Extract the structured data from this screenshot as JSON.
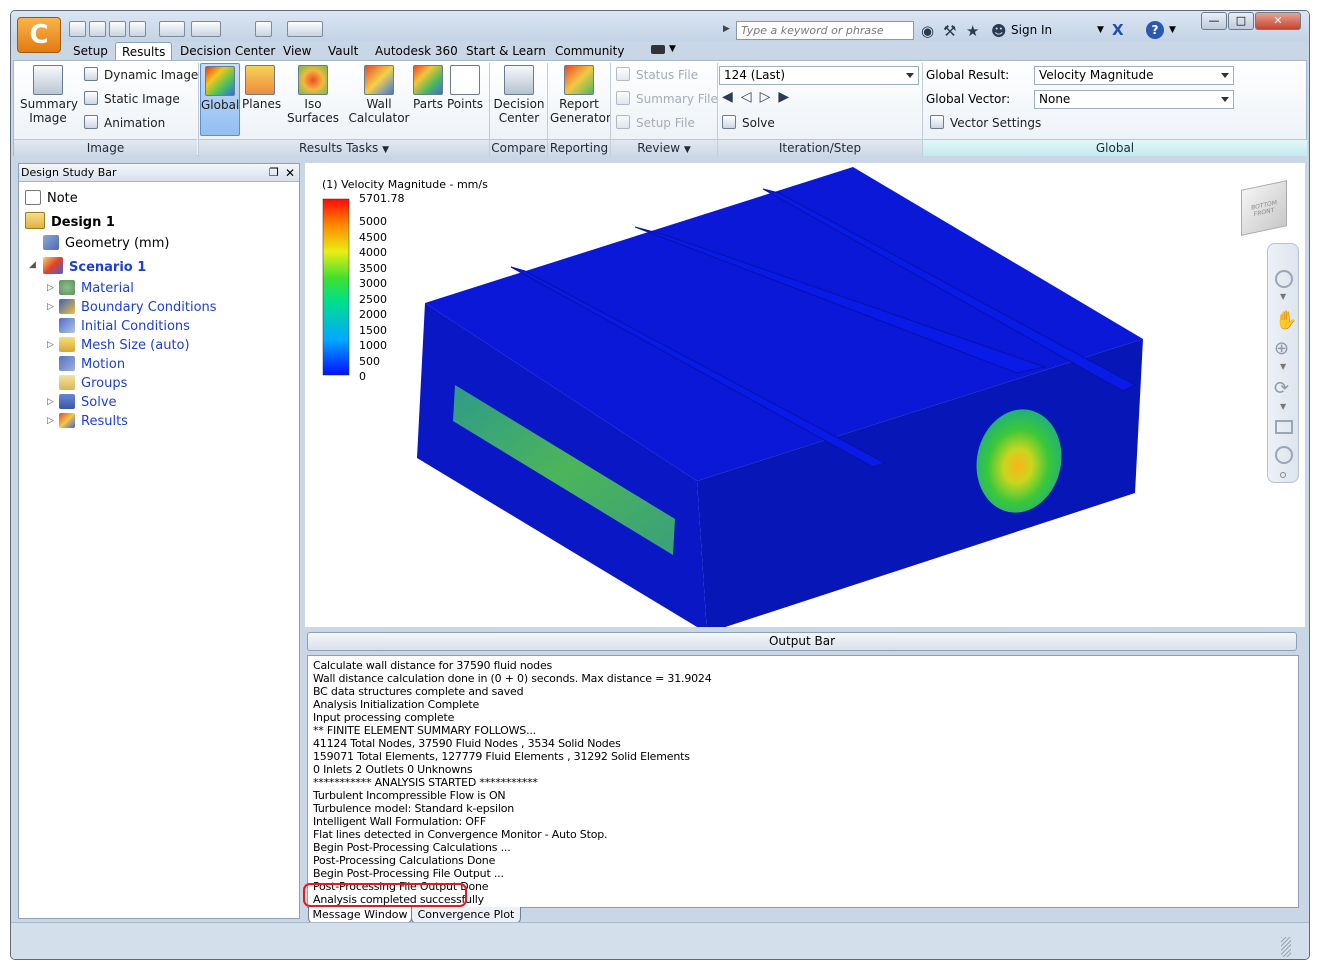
{
  "app": {
    "logo_letter": "C",
    "search_placeholder": "Type a keyword or phrase",
    "sign_in": "Sign In",
    "help": "?"
  },
  "menu_tabs": [
    "Setup",
    "Results",
    "Decision Center",
    "View",
    "Vault",
    "Autodesk 360",
    "Start & Learn",
    "Community"
  ],
  "ribbon": {
    "image": {
      "summary": "Summary Image",
      "summary_l1": "Summary",
      "summary_l2": "Image",
      "dynamic": "Dynamic Image",
      "static": "Static Image",
      "animation": "Animation",
      "group": "Image"
    },
    "results_tasks": {
      "global": "Global",
      "planes": "Planes",
      "iso": "Iso Surfaces",
      "wall_l1": "Wall",
      "wall_l2": "Calculator",
      "parts": "Parts",
      "points": "Points",
      "group": "Results Tasks"
    },
    "compare": {
      "dc_l1": "Decision",
      "dc_l2": "Center",
      "group": "Compare"
    },
    "reporting": {
      "rg_l1": "Report",
      "rg_l2": "Generator",
      "group": "Reporting"
    },
    "review": {
      "status": "Status File",
      "summary": "Summary File",
      "setup": "Setup File",
      "group": "Review"
    },
    "iteration": {
      "value": "124 (Last)",
      "solve": "Solve",
      "group": "Iteration/Step"
    },
    "global": {
      "result_label": "Global Result:",
      "result_value": "Velocity Magnitude",
      "vector_label": "Global Vector:",
      "vector_value": "None",
      "vector_settings": "Vector Settings",
      "group": "Global"
    }
  },
  "design_study_bar": {
    "title": "Design Study Bar",
    "items": {
      "note": "Note",
      "design": "Design 1",
      "geometry": "Geometry (mm)",
      "scenario": "Scenario 1",
      "material": "Material",
      "bc": "Boundary Conditions",
      "ic": "Initial Conditions",
      "mesh": "Mesh Size (auto)",
      "motion": "Motion",
      "groups": "Groups",
      "solve": "Solve",
      "results": "Results"
    }
  },
  "legend": {
    "title": "(1) Velocity Magnitude - mm/s",
    "max": "5701.78",
    "ticks": [
      "5000",
      "4500",
      "4000",
      "3500",
      "3000",
      "2500",
      "2000",
      "1500",
      "1000",
      "500",
      "0"
    ]
  },
  "viewcube": {
    "face": "BOTTOM",
    "side": "FRONT"
  },
  "output": {
    "title": "Output Bar",
    "lines": [
      "Calculate wall distance for 37590 fluid nodes",
      "Wall distance calculation done in (0 + 0) seconds. Max distance = 31.9024",
      "BC data structures complete and saved",
      "Analysis Initialization Complete",
      "Input processing complete",
      "** FINITE ELEMENT SUMMARY FOLLOWS...",
      "41124 Total Nodes,   37590 Fluid Nodes ,   3534 Solid Nodes",
      " 159071 Total Elements,  127779 Fluid Elements ,   31292 Solid Elements",
      "0 Inlets   2 Outlets   0 Unknowns",
      "*********** ANALYSIS STARTED ***********",
      "Turbulent Incompressible Flow is ON",
      "Turbulence model: Standard k-epsilon",
      "Intelligent Wall Formulation: OFF",
      "Flat lines detected in Convergence Monitor - Auto Stop.",
      "Begin Post-Processing Calculations ...",
      "Post-Processing Calculations Done",
      "Begin Post-Processing File Output ...",
      "Post-Processing File Output Done",
      "Analysis completed successfully"
    ],
    "tabs": [
      "Message Window",
      "Convergence Plot"
    ]
  }
}
